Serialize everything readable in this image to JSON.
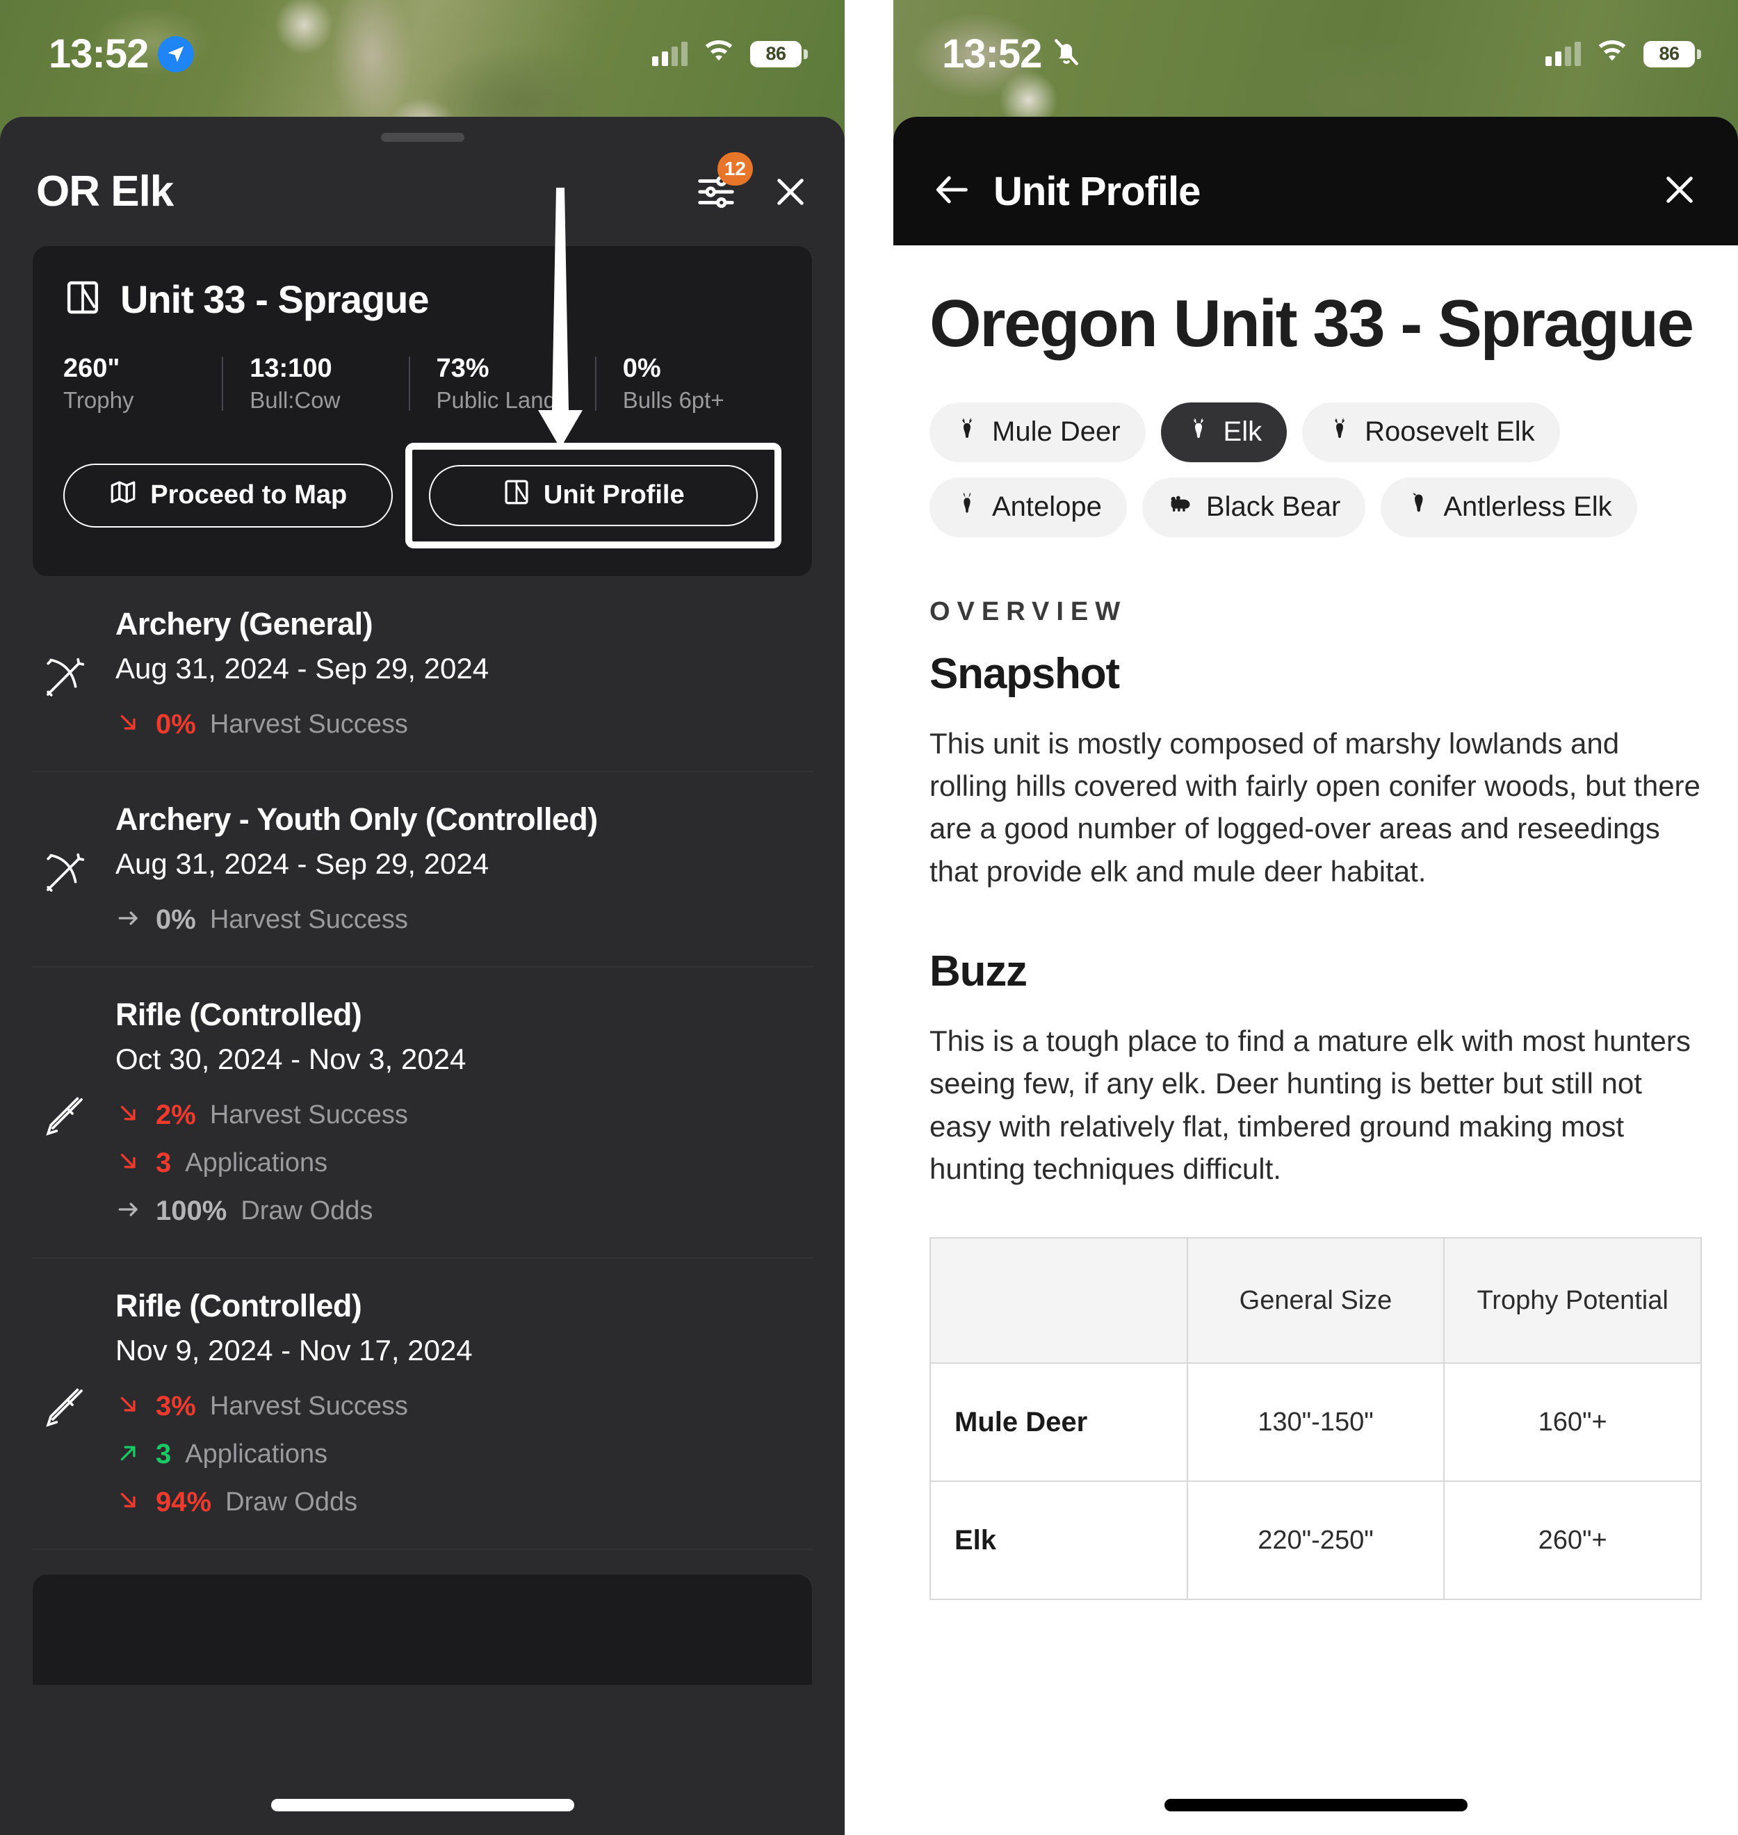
{
  "status_bar": {
    "time": "13:52",
    "left_icon": "location-arrow-icon",
    "right_icon_silent": "bell-slash-icon",
    "signal": "cellular-bars-icon",
    "wifi": "wifi-icon",
    "battery_level": "86"
  },
  "left_pane": {
    "header": {
      "title": "OR Elk",
      "filter_icon": "sliders-icon",
      "filter_badge": "12",
      "close_icon": "close-icon"
    },
    "unit_card": {
      "icon": "unit-boundary-icon",
      "name": "Unit 33 - Sprague",
      "stats": [
        {
          "value": "260\"",
          "label": "Trophy"
        },
        {
          "value": "13:100",
          "label": "Bull:Cow"
        },
        {
          "value": "73%",
          "label": "Public Land"
        },
        {
          "value": "0%",
          "label": "Bulls 6pt+"
        }
      ],
      "buttons": {
        "map": {
          "label": "Proceed to Map",
          "icon": "map-icon"
        },
        "profile": {
          "label": "Unit Profile",
          "icon": "unit-boundary-icon",
          "highlighted": true
        }
      }
    },
    "seasons": [
      {
        "icon": "bow-icon",
        "name": "Archery (General)",
        "dates": "Aug 31, 2024 - Sep 29, 2024",
        "metrics": [
          {
            "trend": "down",
            "value": "0%",
            "label": "Harvest Success"
          }
        ]
      },
      {
        "icon": "bow-icon",
        "name": "Archery - Youth Only (Controlled)",
        "dates": "Aug 31, 2024 - Sep 29, 2024",
        "metrics": [
          {
            "trend": "flat",
            "value": "0%",
            "label": "Harvest Success"
          }
        ]
      },
      {
        "icon": "rifle-icon",
        "name": "Rifle (Controlled)",
        "dates": "Oct 30, 2024 - Nov 3, 2024",
        "metrics": [
          {
            "trend": "down",
            "value": "2%",
            "label": "Harvest Success"
          },
          {
            "trend": "down",
            "value": "3",
            "label": "Applications"
          },
          {
            "trend": "flat",
            "value": "100%",
            "label": "Draw Odds"
          }
        ]
      },
      {
        "icon": "rifle-icon",
        "name": "Rifle (Controlled)",
        "dates": "Nov 9, 2024 - Nov 17, 2024",
        "metrics": [
          {
            "trend": "down",
            "value": "3%",
            "label": "Harvest Success"
          },
          {
            "trend": "up",
            "value": "3",
            "label": "Applications"
          },
          {
            "trend": "down",
            "value": "94%",
            "label": "Draw Odds"
          }
        ]
      }
    ]
  },
  "right_pane": {
    "header": {
      "back_icon": "back-arrow-icon",
      "title": "Unit Profile",
      "close_icon": "close-icon"
    },
    "page_title": "Oregon Unit 33 - Sprague",
    "species_chips": [
      {
        "label": "Mule Deer",
        "icon": "deer-head-icon",
        "active": false
      },
      {
        "label": "Elk",
        "icon": "elk-head-icon",
        "active": true
      },
      {
        "label": "Roosevelt Elk",
        "icon": "elk-head-icon",
        "active": false
      },
      {
        "label": "Antelope",
        "icon": "antelope-head-icon",
        "active": false
      },
      {
        "label": "Black Bear",
        "icon": "bear-icon",
        "active": false
      },
      {
        "label": "Antlerless Elk",
        "icon": "elk-cow-head-icon",
        "active": false
      }
    ],
    "eyebrow": "OVERVIEW",
    "snapshot": {
      "heading": "Snapshot",
      "text": "This unit is mostly composed of marshy lowlands and rolling hills covered with fairly open conifer woods, but there are a good number of logged-over areas and reseedings that provide elk and mule deer habitat."
    },
    "buzz": {
      "heading": "Buzz",
      "text": "This is a tough place to find a mature elk with most hunters seeing few, if any elk. Deer hunting is better but still not easy with relatively flat, timbered ground making most hunting techniques difficult."
    },
    "size_table": {
      "headers": [
        "",
        "General Size",
        "Trophy Potential"
      ],
      "rows": [
        {
          "species": "Mule Deer",
          "general_size": "130\"-150\"",
          "trophy_potential": "160\"+"
        },
        {
          "species": "Elk",
          "general_size": "220\"-250\"",
          "trophy_potential": "260\"+"
        }
      ]
    }
  },
  "annotation": {
    "arrow": "down-arrow-annotation",
    "highlight_box": "unit-profile-highlight-box",
    "color": "#ffffff"
  }
}
